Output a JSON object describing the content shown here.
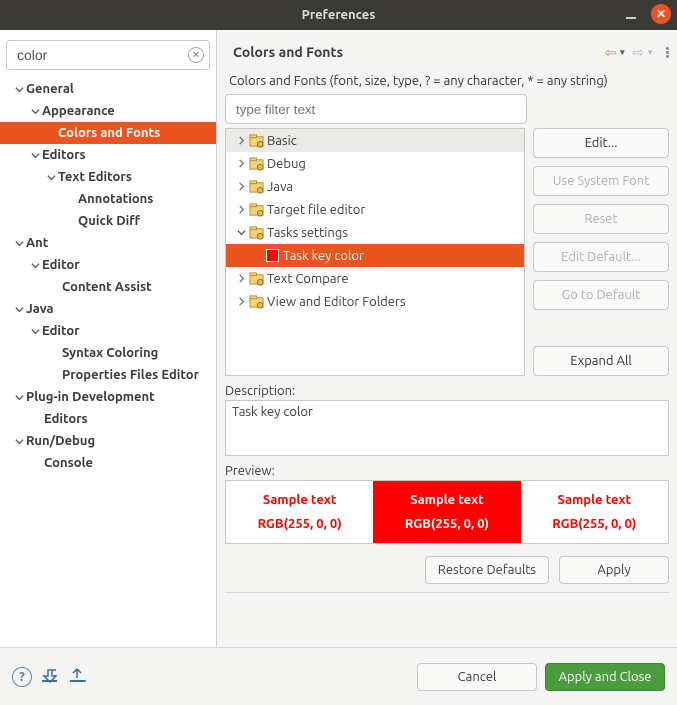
{
  "window": {
    "title": "Preferences"
  },
  "search": {
    "value": "color"
  },
  "left_tree": {
    "general": "General",
    "appearance": "Appearance",
    "colors_fonts": "Colors and Fonts",
    "editors": "Editors",
    "text_editors": "Text Editors",
    "annotations": "Annotations",
    "quick_diff": "Quick Diff",
    "ant": "Ant",
    "ant_editor": "Editor",
    "content_assist": "Content Assist",
    "java": "Java",
    "java_editor": "Editor",
    "syntax_coloring": "Syntax Coloring",
    "properties_files_editor": "Properties Files Editor",
    "plugin_dev": "Plug-in Development",
    "plugin_editors": "Editors",
    "run_debug": "Run/Debug",
    "console": "Console"
  },
  "right": {
    "title": "Colors and Fonts",
    "hint": "Colors and Fonts (font, size, type, ? = any character, * = any string)",
    "filter_placeholder": "type filter text",
    "tree": {
      "basic": "Basic",
      "debug": "Debug",
      "java": "Java",
      "target_file_editor": "Target file editor",
      "tasks_settings": "Tasks settings",
      "task_key_color": "Task key color",
      "text_compare": "Text Compare",
      "view_editor_folders": "View and Editor Folders"
    },
    "buttons": {
      "edit": "Edit...",
      "use_system_font": "Use System Font",
      "reset": "Reset",
      "edit_default": "Edit Default...",
      "go_to_default": "Go to Default",
      "expand_all": "Expand All"
    },
    "description_label": "Description:",
    "description_text": "Task key color",
    "preview_label": "Preview:",
    "preview_sample": "Sample text",
    "preview_rgb": "RGB(255, 0, 0)",
    "restore_defaults": "Restore Defaults",
    "apply": "Apply"
  },
  "footer": {
    "cancel": "Cancel",
    "apply_close": "Apply and Close"
  }
}
